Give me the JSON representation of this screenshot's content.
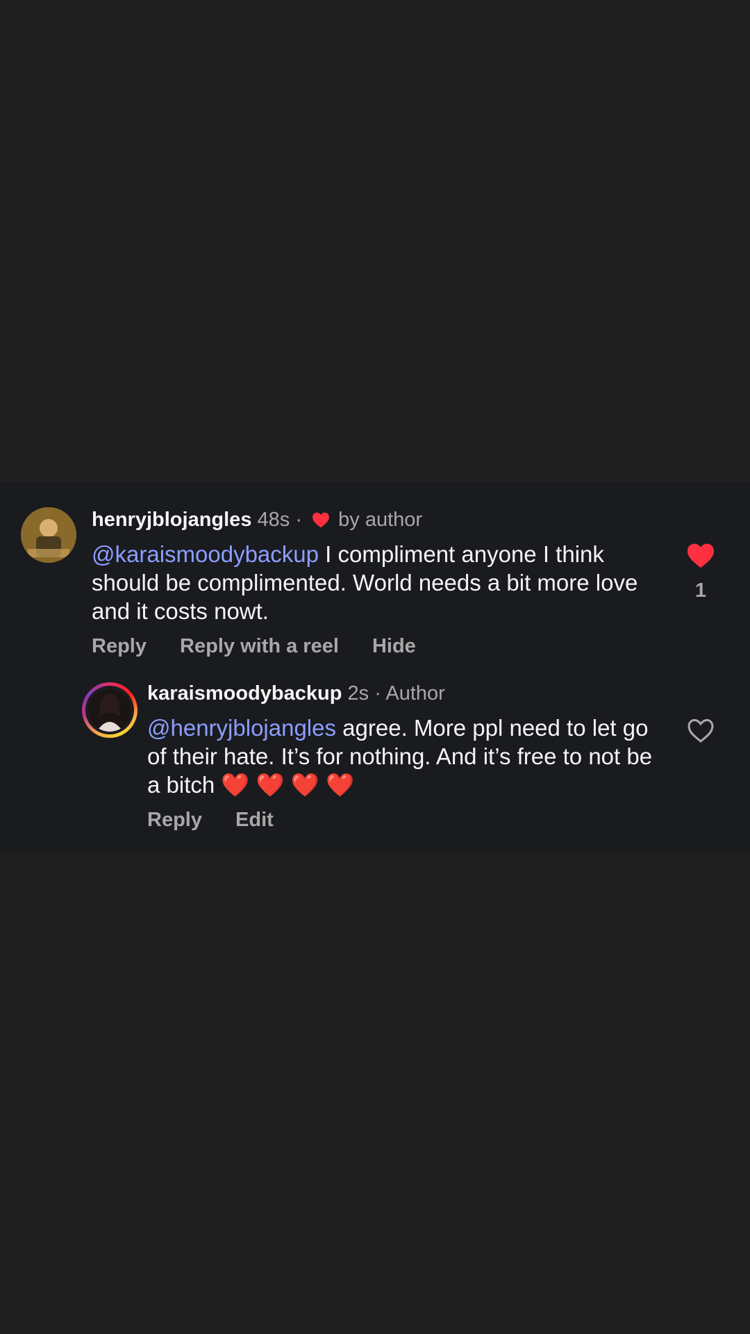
{
  "comments": [
    {
      "username": "henryjblojangles",
      "time": "48s",
      "separator": "·",
      "badge_label": "by author",
      "mention": "@karaismoodybackup",
      "text": " I compliment anyone I think should be complimented. World needs a bit more love and it costs nowt.",
      "actions": [
        "Reply",
        "Reply with a reel",
        "Hide"
      ],
      "like_count": "1",
      "liked": true,
      "avatar": "avatar"
    },
    {
      "username": "karaismoodybackup",
      "time": "2s",
      "separator": "·",
      "author_label": "Author",
      "mention": "@henryjblojangles",
      "text": " agree. More ppl need to let go of their hate. It’s for nothing. And it’s free to not be a bitch ❤️ ❤️ ❤️ ❤️",
      "actions": [
        "Reply",
        "Edit"
      ],
      "liked": false,
      "avatar": "avatar-with-story-ring"
    }
  ],
  "colors": {
    "background": "#1f1f1f",
    "panel": "#191b1f",
    "mention": "#8c9eff",
    "like_red": "#ff3040",
    "muted": "#a8a8a8",
    "text": "#f5f5f5"
  },
  "icons": {
    "liked": "heart-filled-icon",
    "unliked": "heart-outline-icon"
  }
}
